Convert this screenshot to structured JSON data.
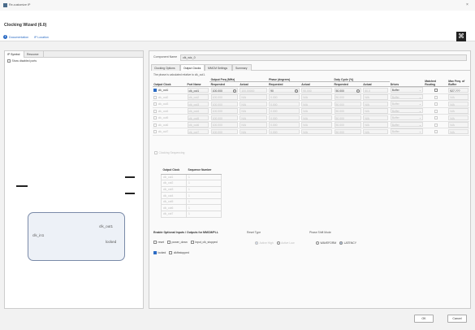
{
  "window": {
    "title": "Re-customize IP",
    "close": "×"
  },
  "header": {
    "wizard_title": "Clocking Wizard (6.0)",
    "links": [
      "Documentation",
      "IP Location"
    ]
  },
  "left_panel": {
    "tabs": [
      "IP Symbol",
      "Resource"
    ],
    "show_disabled_ports": "Show disabled ports",
    "symbol": {
      "input_port": "clk_in1",
      "output_ports": [
        "clk_out1",
        "locked"
      ]
    }
  },
  "right_panel": {
    "component_name_label": "Component Name",
    "component_name": "clk_wiz_0",
    "tabs": [
      "Clocking Options",
      "Output Clocks",
      "MMCM Settings",
      "Summary"
    ],
    "note": "The phase is calculated relative to clk_out1.",
    "table": {
      "headers": {
        "output_clock": "Output Clock",
        "port_name": "Port Name",
        "out_freq": "Output Freq (MHz)",
        "phase": "Phase (degrees)",
        "duty": "Duty Cycle (%)",
        "drives": "Drives",
        "use_fine_ps": "Matched Routing",
        "max_freq": "Max Freq. of Buffer",
        "requested": "Requested",
        "actual": "Actual"
      },
      "rows": [
        {
          "clock": "clk_out1",
          "port": "clk_out1",
          "freq_req": "100.000",
          "freq_act": "100.00000",
          "phase_req": "90",
          "phase_act": "90.000",
          "duty_req": "50.000",
          "duty_act": "50.0",
          "drives": "Buffer",
          "matched": false,
          "max": "927.???",
          "enabled": true
        },
        {
          "clock": "clk_out2",
          "port": "clk_out2",
          "freq_req": "100.000",
          "freq_act": "N/A",
          "phase_req": "0.000",
          "phase_act": "N/A",
          "duty_req": "50.000",
          "duty_act": "N/A",
          "drives": "Buffer",
          "matched": false,
          "max": "N/A",
          "enabled": false
        },
        {
          "clock": "clk_out3",
          "port": "clk_out3",
          "freq_req": "100.000",
          "freq_act": "N/A",
          "phase_req": "0.000",
          "phase_act": "N/A",
          "duty_req": "50.000",
          "duty_act": "N/A",
          "drives": "Buffer",
          "matched": false,
          "max": "N/A",
          "enabled": false
        },
        {
          "clock": "clk_out4",
          "port": "clk_out4",
          "freq_req": "100.000",
          "freq_act": "N/A",
          "phase_req": "0.000",
          "phase_act": "N/A",
          "duty_req": "50.000",
          "duty_act": "N/A",
          "drives": "Buffer",
          "matched": false,
          "max": "N/A",
          "enabled": false
        },
        {
          "clock": "clk_out5",
          "port": "clk_out5",
          "freq_req": "100.000",
          "freq_act": "N/A",
          "phase_req": "0.000",
          "phase_act": "N/A",
          "duty_req": "50.000",
          "duty_act": "N/A",
          "drives": "Buffer",
          "matched": false,
          "max": "N/A",
          "enabled": false
        },
        {
          "clock": "clk_out6",
          "port": "clk_out6",
          "freq_req": "100.000",
          "freq_act": "N/A",
          "phase_req": "0.000",
          "phase_act": "N/A",
          "duty_req": "50.000",
          "duty_act": "N/A",
          "drives": "Buffer",
          "matched": false,
          "max": "N/A",
          "enabled": false
        },
        {
          "clock": "clk_out7",
          "port": "clk_out7",
          "freq_req": "100.000",
          "freq_act": "N/A",
          "phase_req": "0.000",
          "phase_act": "N/A",
          "duty_req": "50.000",
          "duty_act": "N/A",
          "drives": "Buffer",
          "matched": false,
          "max": "N/A",
          "enabled": false
        }
      ]
    },
    "clock_seq_label": "Clocking Sequencing",
    "seq_table": {
      "headers": [
        "Output Clock",
        "Sequence Number"
      ],
      "rows": [
        [
          "clk_out1",
          "1"
        ],
        [
          "clk_out2",
          "1"
        ],
        [
          "clk_out3",
          "1"
        ],
        [
          "clk_out4",
          "1"
        ],
        [
          "clk_out5",
          "1"
        ],
        [
          "clk_out6",
          "1"
        ],
        [
          "clk_out7",
          "1"
        ]
      ]
    },
    "optional": {
      "section_title": "Enable Optional Inputs / Outputs for MMCM/PLL",
      "checks": [
        {
          "label": "reset",
          "checked": false
        },
        {
          "label": "power_down",
          "checked": false
        },
        {
          "label": "input_clk_stopped",
          "checked": false
        },
        {
          "label": "locked",
          "checked": true
        },
        {
          "label": "clkfbstopped",
          "checked": false
        }
      ],
      "reset_type": {
        "title": "Reset Type",
        "options": [
          "Active High",
          "Active Low"
        ],
        "selected": 0
      },
      "phase_shift": {
        "title": "Phase Shift Mode",
        "options": [
          "WAVEFORM",
          "LATENCY"
        ],
        "selected": 1
      }
    }
  },
  "footer": {
    "ok": "OK",
    "cancel": "Cancel"
  }
}
